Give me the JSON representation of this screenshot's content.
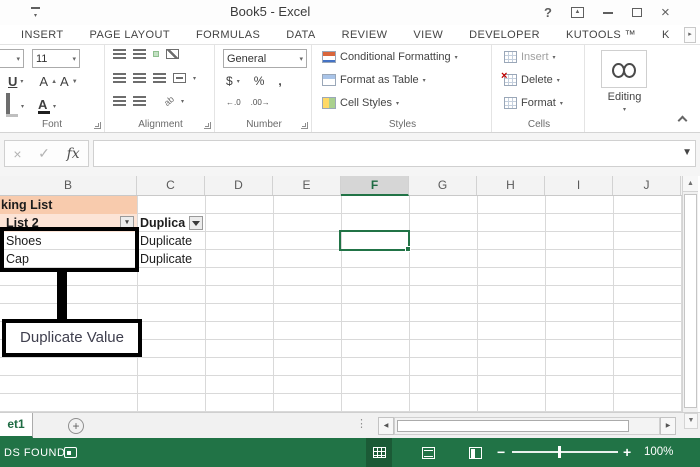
{
  "icons": {
    "dropdown": "▾",
    "down": "▼",
    "up": "▲",
    "left_arrow": "◀",
    "right_arrow": "▶",
    "more_tabs": "▸",
    "check": "✓",
    "cross": "×",
    "help": "?",
    "dots": "⋮",
    "plus": "+",
    "fx": "fx",
    "underline": "U",
    "font_grow": "A",
    "font_shrink": "A",
    "font_color": "A",
    "currency": "$",
    "percent": "%",
    "comma": ",",
    "inc_decimal": "←.0",
    "dec_decimal": ".00→",
    "orientation": "ab"
  },
  "titlebar": {
    "title": "Book5 - Excel"
  },
  "tabs": {
    "items": [
      "INSERT",
      "PAGE LAYOUT",
      "FORMULAS",
      "DATA",
      "REVIEW",
      "VIEW",
      "DEVELOPER",
      "KUTOOLS ™",
      "K"
    ]
  },
  "ribbon": {
    "font_size": "11",
    "number_format": "General",
    "group_labels": {
      "font": "Font",
      "alignment": "Alignment",
      "number": "Number",
      "styles": "Styles",
      "cells": "Cells"
    },
    "styles_items": [
      "Conditional Formatting",
      "Format as Table",
      "Cell Styles"
    ],
    "cells_items": [
      "Insert",
      "Delete",
      "Format"
    ],
    "editing_label": "Editing"
  },
  "formula_bar": {
    "value": ""
  },
  "grid": {
    "columns": [
      "B",
      "C",
      "D",
      "E",
      "F",
      "G",
      "H",
      "I",
      "J"
    ],
    "cells": {
      "b1": "king List",
      "b2": "List 2",
      "c2": "Duplica",
      "b3": "Shoes",
      "c3": "Duplicate",
      "b4": "Cap",
      "c4": "Duplicate"
    },
    "annotation": "Duplicate Value"
  },
  "sheet_bar": {
    "active_tab": "et1"
  },
  "status_bar": {
    "message": "DS FOUND",
    "zoom_level": "100%"
  }
}
